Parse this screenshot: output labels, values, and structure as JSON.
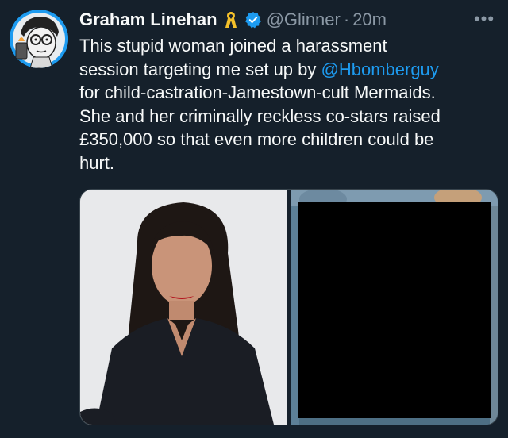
{
  "tweet": {
    "author_name": "Graham Linehan",
    "handle": "@Glinner",
    "separator": "·",
    "timestamp": "20m",
    "more_label": "•••",
    "body": {
      "line1": "This stupid woman joined a harassment",
      "line2_before": "session targeting me set up by ",
      "mention": "@Hbomberguy",
      "line3": "for child-castration-Jamestown-cult Mermaids.",
      "line4": "She and her criminally reckless co-stars raised",
      "line5": "£350,000 so that even more children could be",
      "line6": "hurt."
    }
  },
  "colors": {
    "background": "#15202b",
    "text": "#f7f9f9",
    "secondary": "#8b98a5",
    "accent": "#1d9bf0",
    "ribbon": "#f4c02a"
  },
  "icons": {
    "verified": "verified-badge-icon",
    "ribbon": "yellow-ribbon-icon",
    "more": "more-horizontal-icon"
  }
}
